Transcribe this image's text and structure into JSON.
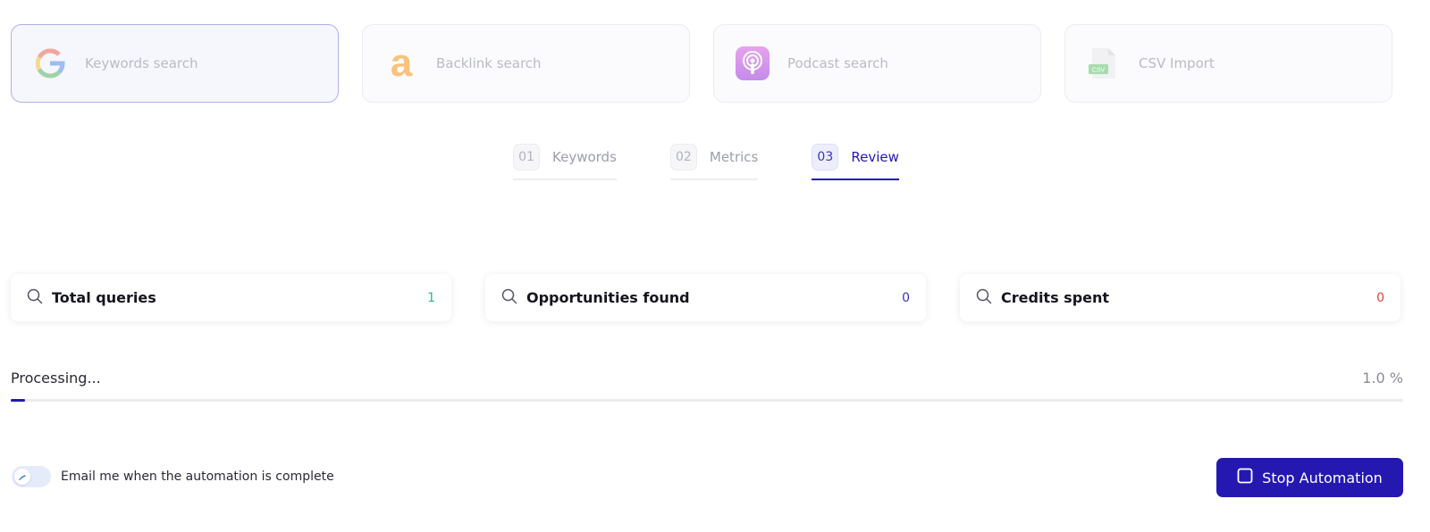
{
  "sources": [
    {
      "label": "Keywords search",
      "icon": "google-icon",
      "active": true
    },
    {
      "label": "Backlink search",
      "icon": "amazon-icon",
      "active": false
    },
    {
      "label": "Podcast search",
      "icon": "podcast-icon",
      "active": false
    },
    {
      "label": "CSV Import",
      "icon": "csv-file-icon",
      "active": false
    }
  ],
  "steps": [
    {
      "num": "01",
      "label": "Keywords"
    },
    {
      "num": "02",
      "label": "Metrics"
    },
    {
      "num": "03",
      "label": "Review"
    }
  ],
  "active_step": "03",
  "stats": [
    {
      "label": "Total queries",
      "value": "1",
      "color": "#1fbf75"
    },
    {
      "label": "Opportunities found",
      "value": "0",
      "color": "#3b33b8"
    },
    {
      "label": "Credits spent",
      "value": "0",
      "color": "#e5463c"
    }
  ],
  "progress": {
    "status": "Processing...",
    "percent_label": "1.0 %",
    "value": 1.0
  },
  "email_toggle": {
    "label": "Email me when the automation is complete"
  },
  "stop_button": {
    "label": "Stop Automation"
  },
  "colors": {
    "accent": "#2418b0",
    "card_border_active": "#aeb0e6"
  }
}
